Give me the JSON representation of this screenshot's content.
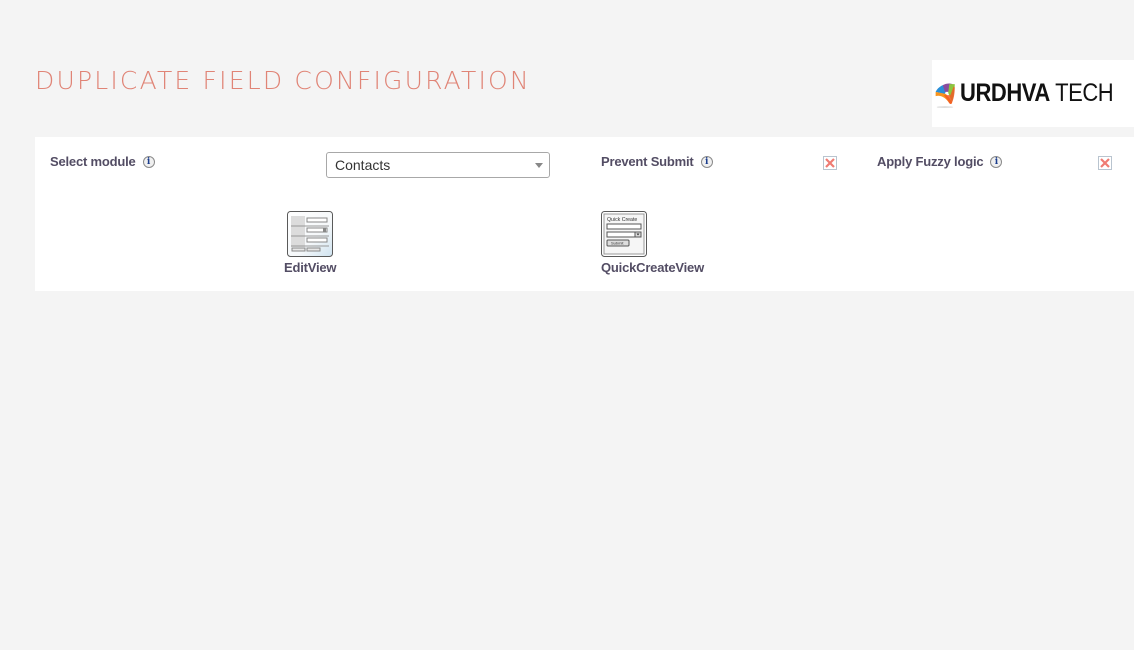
{
  "page": {
    "title": "DUPLICATE FIELD CONFIGURATION"
  },
  "logo": {
    "brand_bold": "URDHVA",
    "brand_light": "TECH",
    "icon": "urdhva-tech-logo-mark"
  },
  "settings": {
    "select_module": {
      "label": "Select module",
      "info_icon": "info-icon",
      "selected_value": "Contacts"
    },
    "prevent_submit": {
      "label": "Prevent Submit",
      "info_icon": "info-icon",
      "state_icon": "red-x-icon",
      "enabled": false
    },
    "apply_fuzzy_logic": {
      "label": "Apply Fuzzy logic",
      "info_icon": "info-icon",
      "state_icon": "red-x-icon",
      "enabled": false
    }
  },
  "views": [
    {
      "label": "EditView",
      "icon": "edit-view-icon"
    },
    {
      "label": "QuickCreateView",
      "icon": "quick-create-view-icon",
      "icon_text": "Quick Create",
      "icon_button": "Submit"
    }
  ],
  "colors": {
    "title": "#e08476",
    "label": "#534d64",
    "background": "#f4f4f4",
    "panel": "#ffffff",
    "x_mark": "#ef7b73"
  }
}
